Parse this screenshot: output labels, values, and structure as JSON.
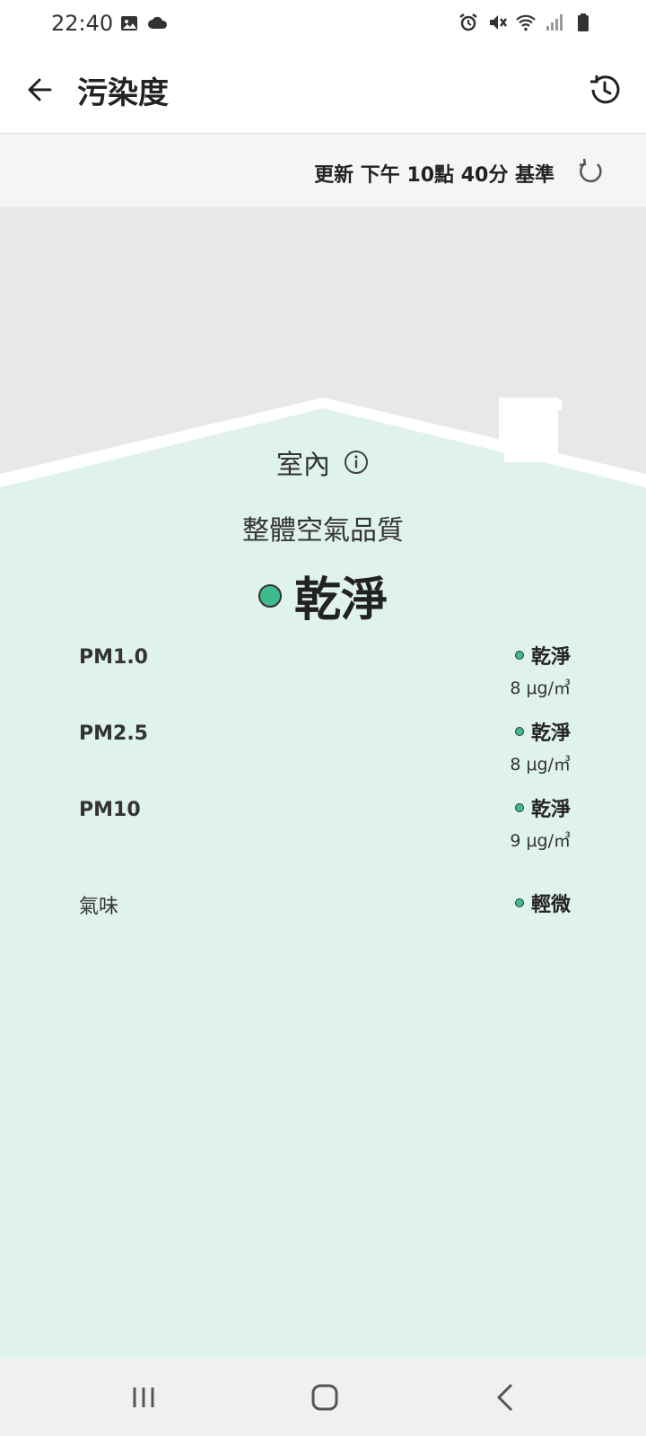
{
  "status_bar": {
    "time": "22:40",
    "left_icons": [
      "image-icon",
      "cloud-icon"
    ],
    "right_icons": [
      "alarm-icon",
      "vibrate-icon",
      "wifi-icon",
      "signal-icon",
      "battery-icon"
    ]
  },
  "app_bar": {
    "title": "污染度",
    "back_icon": "arrow-left-icon",
    "history_icon": "history-icon"
  },
  "update": {
    "text": "更新 下午 10點 40分 基準",
    "refresh_icon": "refresh-icon"
  },
  "indoor": {
    "label": "室內",
    "info_icon": "info-icon",
    "overall_label": "整體空氣品質",
    "overall_value": "乾淨"
  },
  "pollutants": [
    {
      "name": "PM1.0",
      "status": "乾淨",
      "value": "8 μg/㎥"
    },
    {
      "name": "PM2.5",
      "status": "乾淨",
      "value": "8 μg/㎥"
    },
    {
      "name": "PM10",
      "status": "乾淨",
      "value": "9 μg/㎥"
    },
    {
      "name": "氣味",
      "status": "輕微",
      "value": ""
    }
  ],
  "colors": {
    "clean_green": "#3dbb8c",
    "indoor_bg": "#dff2ec",
    "outdoor_bg": "#e8e8e8"
  },
  "nav_bar": {
    "icons": [
      "recent-apps-icon",
      "home-icon",
      "back-icon"
    ]
  }
}
